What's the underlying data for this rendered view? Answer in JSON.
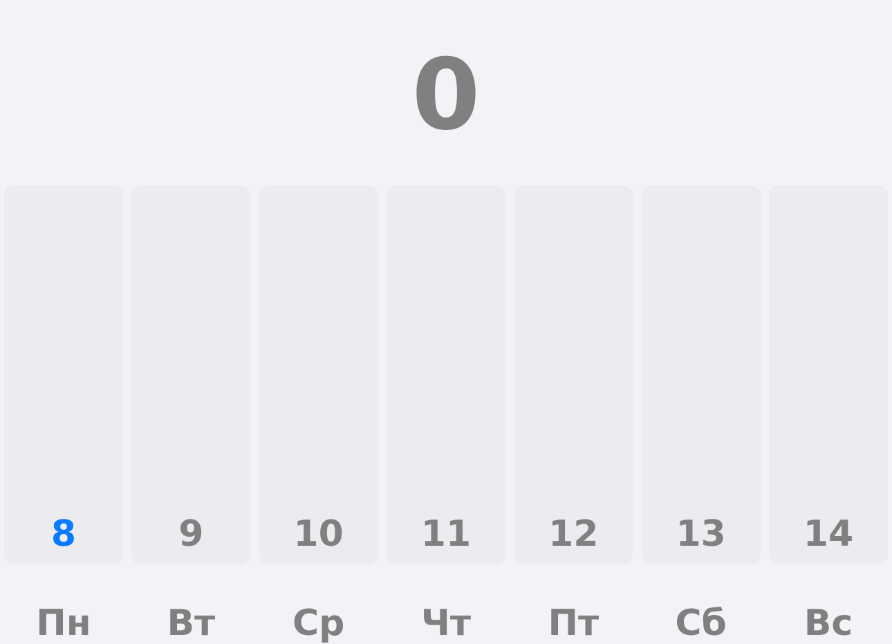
{
  "total": {
    "value": "0"
  },
  "colors": {
    "background": "#f2f2f7",
    "column": "#ebebf0",
    "text": "#808080",
    "accent": "#0a7aff"
  },
  "days": [
    {
      "number": "8",
      "weekday": "Пн",
      "selected": true
    },
    {
      "number": "9",
      "weekday": "Вт",
      "selected": false
    },
    {
      "number": "10",
      "weekday": "Ср",
      "selected": false
    },
    {
      "number": "11",
      "weekday": "Чт",
      "selected": false
    },
    {
      "number": "12",
      "weekday": "Пт",
      "selected": false
    },
    {
      "number": "13",
      "weekday": "Сб",
      "selected": false
    },
    {
      "number": "14",
      "weekday": "Вс",
      "selected": false
    }
  ]
}
